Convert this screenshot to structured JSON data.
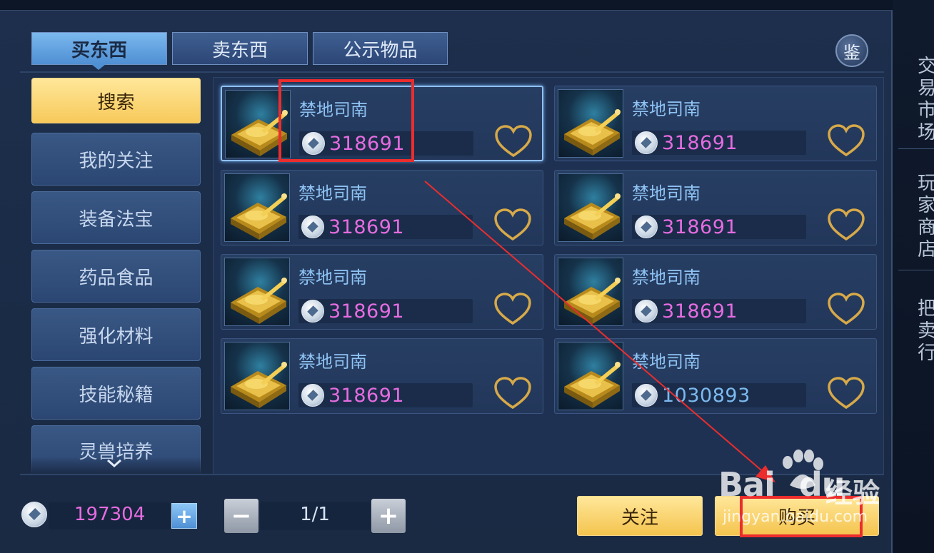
{
  "tabs": [
    {
      "label": "买东西",
      "active": true
    },
    {
      "label": "卖东西",
      "active": false
    },
    {
      "label": "公示物品",
      "active": false
    }
  ],
  "appraise_label": "鉴",
  "sidebar": {
    "items": [
      {
        "label": "搜索",
        "active": true
      },
      {
        "label": "我的关注",
        "active": false
      },
      {
        "label": "装备法宝",
        "active": false
      },
      {
        "label": "药品食品",
        "active": false
      },
      {
        "label": "强化材料",
        "active": false
      },
      {
        "label": "技能秘籍",
        "active": false
      },
      {
        "label": "灵兽培养",
        "active": false
      }
    ],
    "scroll_icon": "chevron-down-icon"
  },
  "listings": [
    {
      "name": "禁地司南",
      "price": "318691",
      "price_color": "#e66ce0",
      "selected": true
    },
    {
      "name": "禁地司南",
      "price": "318691",
      "price_color": "#e66ce0",
      "selected": false
    },
    {
      "name": "禁地司南",
      "price": "318691",
      "price_color": "#e66ce0",
      "selected": false
    },
    {
      "name": "禁地司南",
      "price": "318691",
      "price_color": "#e66ce0",
      "selected": false
    },
    {
      "name": "禁地司南",
      "price": "318691",
      "price_color": "#e66ce0",
      "selected": false
    },
    {
      "name": "禁地司南",
      "price": "318691",
      "price_color": "#e66ce0",
      "selected": false
    },
    {
      "name": "禁地司南",
      "price": "318691",
      "price_color": "#e66ce0",
      "selected": false
    },
    {
      "name": "禁地司南",
      "price": "1030893",
      "price_color": "#7db9ee",
      "selected": false
    }
  ],
  "wallet": {
    "amount": "197304",
    "add_label": "+"
  },
  "pagination": {
    "minus_label": "−",
    "indicator": "1/1",
    "plus_label": "+"
  },
  "actions": {
    "follow_label": "关注",
    "buy_label": "购买"
  },
  "right_panel_text": [
    "交",
    "易",
    "市",
    "场",
    "玩",
    "家",
    "商",
    "店",
    "把",
    "卖",
    "行"
  ],
  "watermark": {
    "logo": "Bai",
    "logo_suffix": "du",
    "product": "经验",
    "url": "jingyan.baidu.com"
  },
  "colors": {
    "accent_gold": "#f7c95a",
    "price_pink": "#e66ce0",
    "annotation_red": "#ec2d2d",
    "tab_blue": "#4f8fd3"
  }
}
